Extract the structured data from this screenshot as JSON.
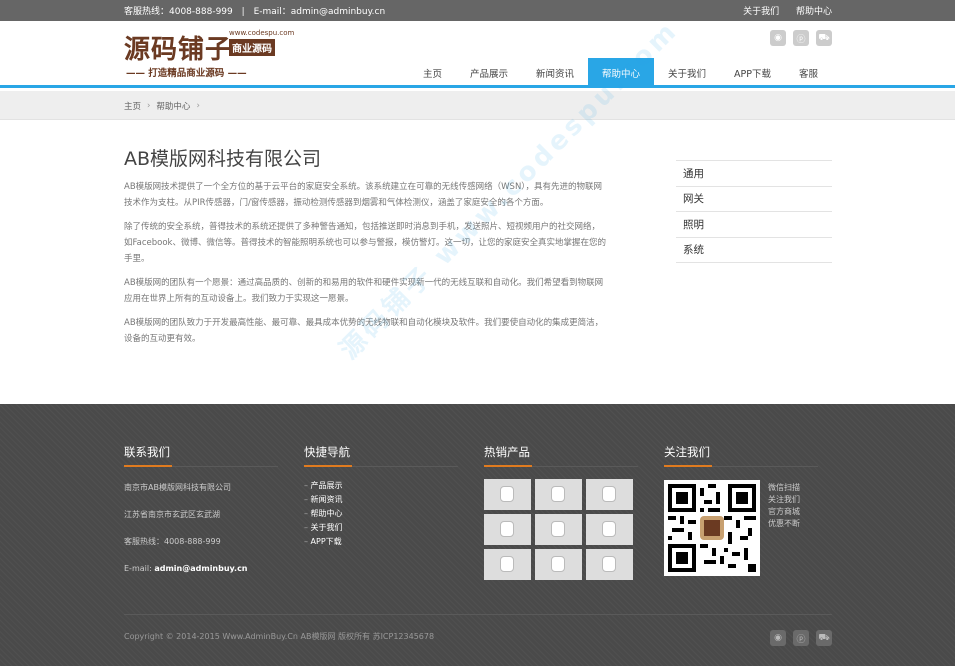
{
  "topbar": {
    "hotline": "客服热线：4008-888-999",
    "email": "E-mail：admin@adminbuy.cn",
    "links": [
      "关于我们",
      "帮助中心"
    ]
  },
  "logo": {
    "name": "源码铺子",
    "url": "www.codespu.com",
    "tag": "商业源码",
    "slogan": "—— 打造精品商业源码 ——"
  },
  "header_icons": [
    "weibo-icon",
    "pinterest-icon",
    "cart-icon"
  ],
  "nav": [
    "主页",
    "产品展示",
    "新闻资讯",
    "帮助中心",
    "关于我们",
    "APP下载",
    "客服"
  ],
  "nav_active": 3,
  "breadcrumb": [
    "主页",
    "帮助中心"
  ],
  "main": {
    "title": "AB模版网科技有限公司",
    "paragraphs": [
      "AB模版网技术提供了一个全方位的基于云平台的家庭安全系统。该系统建立在可靠的无线传感网络（WSN），具有先进的物联网技术作为支柱。从PIR传感器，门/窗传感器，振动检测传感器到烟雾和气体检测仪，涵盖了家庭安全的各个方面。",
      "除了传统的安全系统，普得技术的系统还提供了多种警告通知，包括推送即时消息到手机，发送照片、短视频用户的社交网络，如Facebook、微博、微信等。普得技术的智能照明系统也可以参与警报，模仿警灯。这一切，让您的家庭安全真实地掌握在您的手里。",
      "AB模版网的团队有一个愿景：通过高品质的、创新的和易用的软件和硬件实现新一代的无线互联和自动化。我们希望看到物联网应用在世界上所有的互动设备上。我们致力于实现这一愿景。",
      "AB模版网的团队致力于开发最高性能、最可靠、最具成本优势的无线物联和自动化模块及软件。我们要使自动化的集成更简洁，设备的互动更有效。"
    ]
  },
  "sidenav": [
    "通用",
    "网关",
    "照明",
    "系统"
  ],
  "watermark": "源码铺子 www.codespu.com",
  "footer": {
    "contact_title": "联系我们",
    "contact": {
      "company": "南京市AB模版网科技有限公司",
      "address": "江苏省南京市玄武区玄武湖",
      "hotline": "客服热线：4008-888-999",
      "email_label": "E-mail: ",
      "email": "admin@adminbuy.cn"
    },
    "quick_title": "快捷导航",
    "quick_links": [
      "产品展示",
      "新闻资讯",
      "帮助中心",
      "关于我们",
      "APP下载"
    ],
    "products_title": "热销产品",
    "products_count": 9,
    "follow_title": "关注我们",
    "follow_lines": [
      "微信扫描",
      "关注我们",
      "官方商城",
      "优惠不断"
    ],
    "copyright": "Copyright © 2014-2015 Www.AdminBuy.Cn AB模版网 版权所有   苏ICP12345678"
  }
}
